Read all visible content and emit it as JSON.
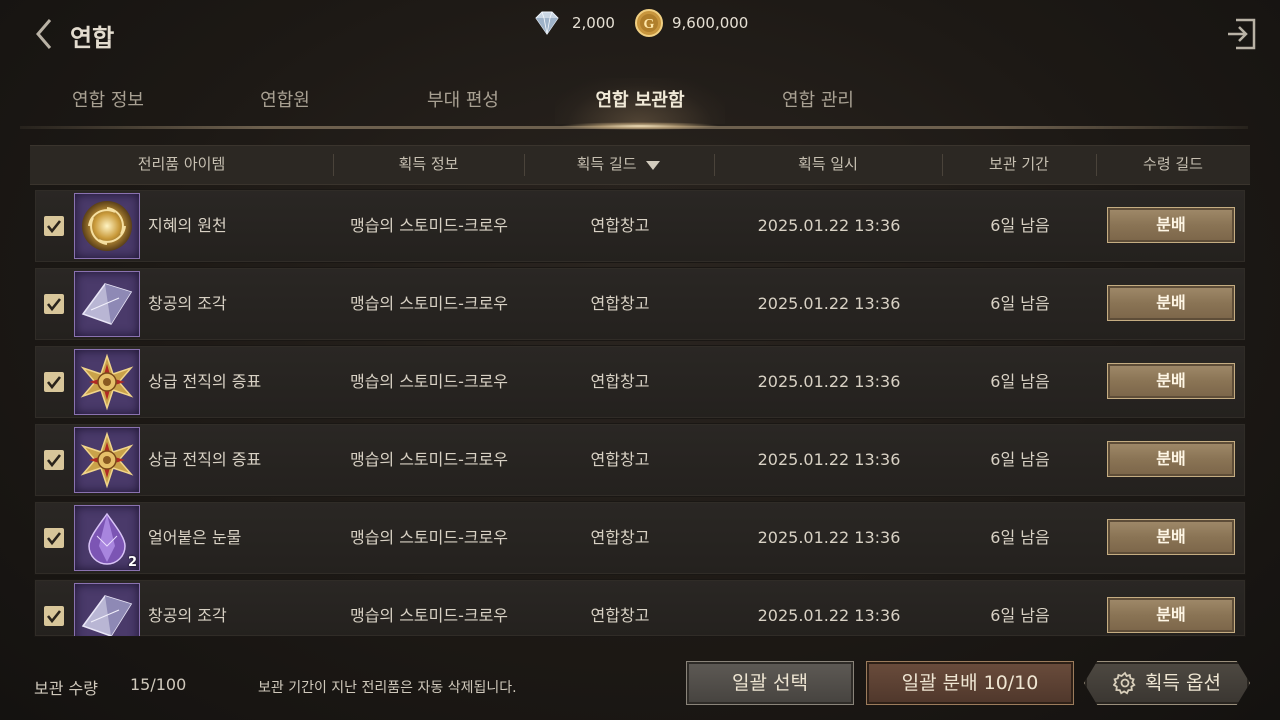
{
  "header": {
    "title": "연합",
    "back_icon": "chevron-left-icon",
    "exit_icon": "exit-door-icon",
    "diamond": "2,000",
    "gold": "9,600,000",
    "gold_icon_letter": "G"
  },
  "tabs": [
    {
      "label": "연합 정보",
      "active": false
    },
    {
      "label": "연합원",
      "active": false
    },
    {
      "label": "부대 편성",
      "active": false
    },
    {
      "label": "연합 보관함",
      "active": true
    },
    {
      "label": "연합 관리",
      "active": false
    }
  ],
  "table": {
    "columns": [
      "전리품 아이템",
      "획득 정보",
      "획득 길드",
      "획득 일시",
      "보관 기간",
      "수령 길드"
    ],
    "sort_icon": "triangle-down-icon",
    "rows": [
      {
        "checked": true,
        "item": "지혜의 원천",
        "icon": "wisdom-orb-icon",
        "count": "",
        "info": "맹습의 스토미드-크로우",
        "guild": "연합창고",
        "date": "2025.01.22 13:36",
        "period": "6일 남음",
        "action": "분배"
      },
      {
        "checked": true,
        "item": "창공의 조각",
        "icon": "sky-shard-icon",
        "count": "",
        "info": "맹습의 스토미드-크로우",
        "guild": "연합창고",
        "date": "2025.01.22 13:36",
        "period": "6일 남음",
        "action": "분배"
      },
      {
        "checked": true,
        "item": "상급 전직의 증표",
        "icon": "medal-icon",
        "count": "",
        "info": "맹습의 스토미드-크로우",
        "guild": "연합창고",
        "date": "2025.01.22 13:36",
        "period": "6일 남음",
        "action": "분배"
      },
      {
        "checked": true,
        "item": "상급 전직의 증표",
        "icon": "medal-icon",
        "count": "",
        "info": "맹습의 스토미드-크로우",
        "guild": "연합창고",
        "date": "2025.01.22 13:36",
        "period": "6일 남음",
        "action": "분배"
      },
      {
        "checked": true,
        "item": "얼어붙은 눈물",
        "icon": "frozen-tear-gem-icon",
        "count": "2",
        "info": "맹습의 스토미드-크로우",
        "guild": "연합창고",
        "date": "2025.01.22 13:36",
        "period": "6일 남음",
        "action": "분배"
      },
      {
        "checked": true,
        "item": "창공의 조각",
        "icon": "sky-shard-icon",
        "count": "",
        "info": "맹습의 스토미드-크로우",
        "guild": "연합창고",
        "date": "2025.01.22 13:36",
        "period": "6일 남음",
        "action": "분배"
      }
    ]
  },
  "footer": {
    "storage_label": "보관 수량",
    "storage_value": "15/100",
    "notice": "보관 기간이 지난 전리품은 자동 삭제됩니다.",
    "select_all": "일괄 선택",
    "distribute_all": "일괄 분배 10/10",
    "options": "획득 옵션",
    "options_icon": "gear-icon"
  },
  "colors": {
    "accent_button": "#8a7455",
    "item_frame": "#4a3a6a",
    "checkbox": "#d8c69a"
  }
}
